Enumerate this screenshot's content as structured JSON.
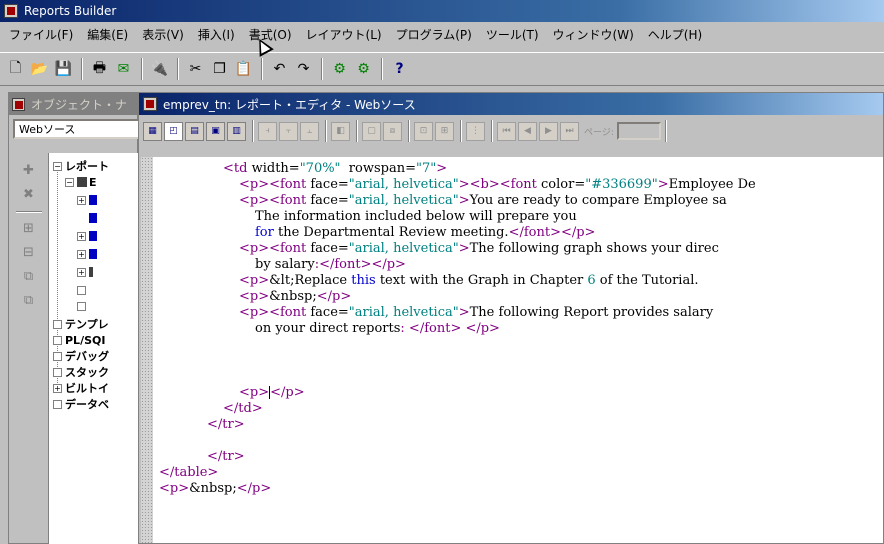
{
  "app": {
    "title": "Reports Builder"
  },
  "menu": [
    "ファイル(F)",
    "編集(E)",
    "表示(V)",
    "挿入(I)",
    "書式(O)",
    "レイアウト(L)",
    "プログラム(P)",
    "ツール(T)",
    "ウィンドウ(W)",
    "ヘルプ(H)"
  ],
  "toolbar": {
    "icons": [
      "new-icon",
      "open-icon",
      "save-icon",
      "print-icon",
      "mail-icon",
      "connect-icon",
      "cut-icon",
      "copy-icon",
      "paste-icon",
      "undo-icon",
      "redo-icon",
      "compile-icon",
      "run-icon",
      "help-icon"
    ]
  },
  "navigator": {
    "title": "オブジェクト・ナ",
    "view_select": "Webソース",
    "tree_items": [
      {
        "label": "レポート",
        "expanded": true
      },
      {
        "label": "テンプレ",
        "expanded": false
      },
      {
        "label": "PL/SQI",
        "expanded": false
      },
      {
        "label": "デバッグ",
        "expanded": false
      },
      {
        "label": "スタック",
        "expanded": false
      },
      {
        "label": "ビルトイ",
        "expanded": true
      },
      {
        "label": "データベ",
        "expanded": false
      }
    ],
    "report_child": "E"
  },
  "editor": {
    "title": "emprev_tn: レポート・エディタ - Webソース",
    "page_label": "ページ:",
    "page_value": ""
  },
  "code_lines": [
    {
      "indent": 4,
      "html": "<span class='tag'>&lt;td</span> width=<span class='attr-val'>\"70%\"</span>  rowspan=<span class='attr-val'>\"7\"</span><span class='tag'>&gt;</span>"
    },
    {
      "indent": 5,
      "html": "<span class='tag'>&lt;p&gt;&lt;font</span> face=<span class='attr-val'>\"arial, helvetica\"</span><span class='tag'>&gt;&lt;b&gt;&lt;font</span> color=<span class='attr-val'>\"#336699\"</span><span class='tag'>&gt;</span>Employee De"
    },
    {
      "indent": 5,
      "html": "<span class='tag'>&lt;p&gt;&lt;font</span> face=<span class='attr-val'>\"arial, helvetica\"</span><span class='tag'>&gt;</span>You are ready to compare Employee sa"
    },
    {
      "indent": 6,
      "html": "The information included below will prepare you"
    },
    {
      "indent": 6,
      "html": "<span class='kw'>for</span> the Departmental Review meeting.<span class='tag'>&lt;/font&gt;&lt;/p&gt;</span>"
    },
    {
      "indent": 5,
      "html": "<span class='tag'>&lt;p&gt;&lt;font</span> face=<span class='attr-val'>\"arial, helvetica\"</span><span class='tag'>&gt;</span>The following graph shows your direc"
    },
    {
      "indent": 6,
      "html": "by salary<span class='tag'>:&lt;/font&gt;&lt;/p&gt;</span>"
    },
    {
      "indent": 5,
      "html": "<span class='tag'>&lt;p&gt;</span>&amp;lt;Replace <span class='kw'>this</span> text with the Graph in Chapter <span class='attr-val'>6</span> of the Tutorial."
    },
    {
      "indent": 5,
      "html": "<span class='tag'>&lt;p&gt;</span>&amp;nbsp;<span class='tag'>&lt;/p&gt;</span>"
    },
    {
      "indent": 5,
      "html": "<span class='tag'>&lt;p&gt;&lt;font</span> face=<span class='attr-val'>\"arial, helvetica\"</span><span class='tag'>&gt;</span>The following Report provides salary"
    },
    {
      "indent": 6,
      "html": "on your direct reports<span class='tag'>: &lt;/font&gt; &lt;/p&gt;</span>"
    },
    {
      "indent": 0,
      "html": ""
    },
    {
      "indent": 0,
      "html": ""
    },
    {
      "indent": 0,
      "html": ""
    },
    {
      "indent": 5,
      "html": "<span class='tag'>&lt;p&gt;</span><span class='cursor-caret'></span><span class='tag'>&lt;/p&gt;</span>"
    },
    {
      "indent": 4,
      "html": "<span class='tag'>&lt;/td&gt;</span>"
    },
    {
      "indent": 3,
      "html": "<span class='tag'>&lt;/tr&gt;</span>"
    },
    {
      "indent": 0,
      "html": ""
    },
    {
      "indent": 3,
      "html": "<span class='tag'>&lt;/tr&gt;</span>"
    },
    {
      "indent": 0,
      "html": "<span class='tag'>&lt;/table&gt;</span>"
    },
    {
      "indent": 0,
      "html": "<span class='tag'>&lt;p&gt;</span>&amp;nbsp;<span class='tag'>&lt;/p&gt;</span>"
    }
  ]
}
